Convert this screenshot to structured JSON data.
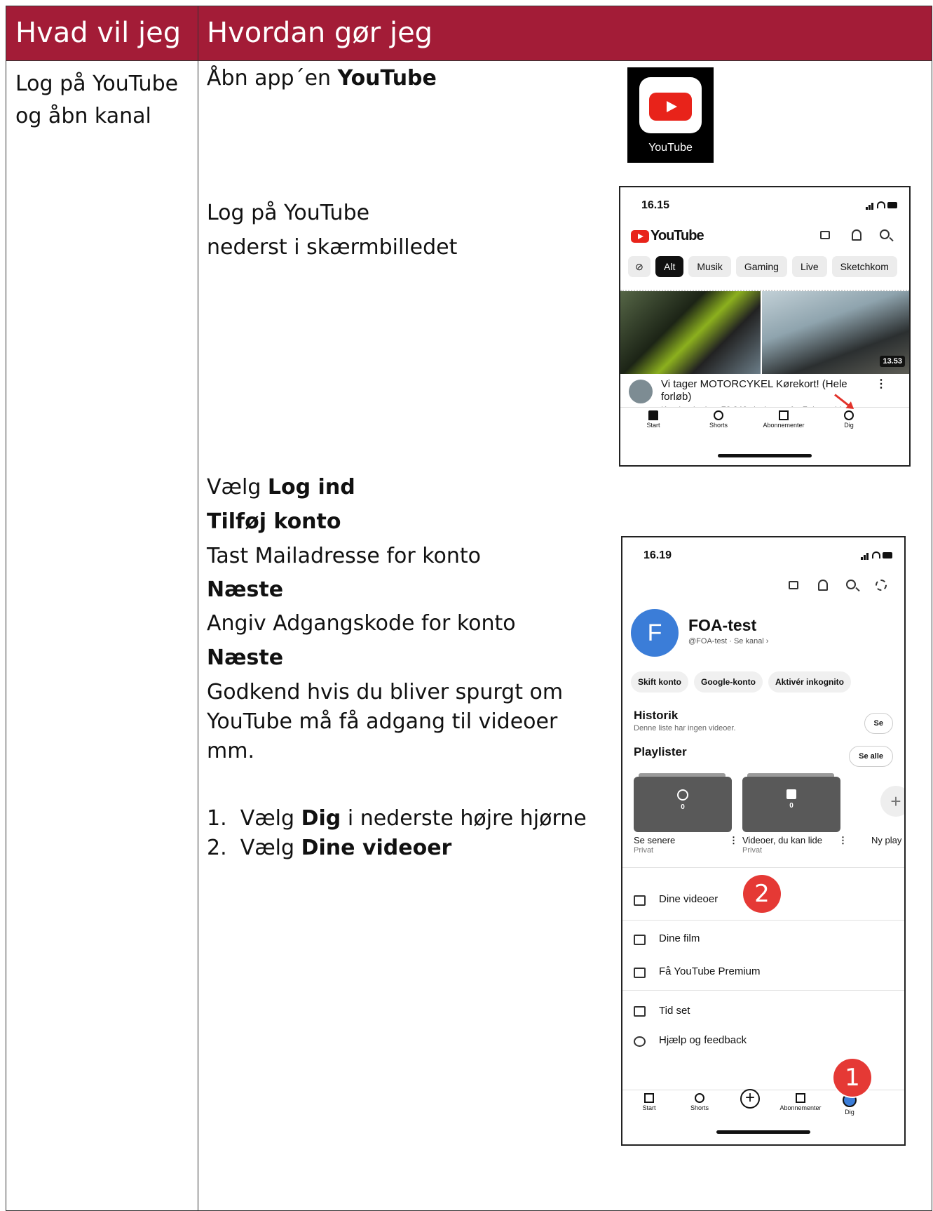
{
  "header": {
    "col1": "Hvad vil jeg",
    "col2": "Hvordan gør jeg"
  },
  "task": {
    "line1": "Log på YouTube",
    "line2": "og åbn kanal"
  },
  "steps": {
    "open_app_pre": "Åbn app´en ",
    "open_app_bold": "YouTube",
    "login_line1": "Log på YouTube",
    "login_line2": "nederst i skærmbilledet",
    "choose_pre": "Vælg ",
    "choose_bold": "Log ind",
    "add_account": "Tilføj konto",
    "enter_mail": "Tast Mailadresse for konto",
    "next1": "Næste",
    "enter_password": "Angiv Adgangskode for konto",
    "next2": "Næste",
    "approve_line1": "Godkend hvis du bliver spurgt om",
    "approve_line2": "YouTube må få adgang til videoer",
    "approve_line3": "mm.",
    "list1_num": "1.",
    "list1_pre": "Vælg ",
    "list1_bold": "Dig",
    "list1_post": " i nederste højre hjørne",
    "list2_num": "2.",
    "list2_pre": "Vælg ",
    "list2_bold": "Dine videoer"
  },
  "app_icon": {
    "label": "YouTube"
  },
  "phone1": {
    "time": "16.15",
    "logo_text": "YouTube",
    "chips": [
      "Alt",
      "Musik",
      "Gaming",
      "Live",
      "Sketchkom"
    ],
    "duration": "13.53",
    "video_title": "Vi tager MOTORCYKEL Kørekort! (Hele forløb)",
    "video_meta": "Kender du det · 78.246 visninger · for 7 dage siden",
    "nav": [
      "Start",
      "Shorts",
      "Abonnementer",
      "Dig"
    ]
  },
  "phone2": {
    "time": "16.19",
    "avatar_letter": "F",
    "profile_name": "FOA-test",
    "profile_handle": "@FOA-test · Se kanal ›",
    "chips": [
      "Skift konto",
      "Google-konto",
      "Aktivér inkognito"
    ],
    "history_title": "Historik",
    "history_sub": "Denne liste har ingen videoer.",
    "history_btn": "Se",
    "playlists_title": "Playlister",
    "playlists_btn": "Se alle",
    "playlists": [
      {
        "count": "0",
        "title": "Se senere",
        "sub": "Privat"
      },
      {
        "count": "0",
        "title": "Videoer, du kan lide",
        "sub": "Privat"
      }
    ],
    "new_playlist": "Ny play",
    "menu": [
      "Dine videoer",
      "Dine film",
      "Få YouTube Premium",
      "Tid set",
      "Hjælp og feedback"
    ],
    "nav": [
      "Start",
      "Shorts",
      "",
      "Abonnementer",
      "Dig"
    ],
    "avatar_small": "F"
  },
  "badges": {
    "one": "1",
    "two": "2"
  },
  "colors": {
    "header_bg": "#a31c37",
    "yt_red": "#e8231a",
    "badge_red": "#e53935",
    "avatar_blue": "#3b7dd8"
  }
}
